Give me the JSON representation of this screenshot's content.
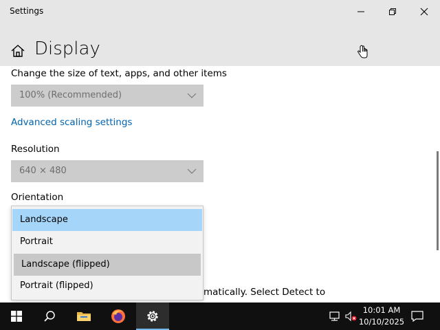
{
  "window": {
    "title": "Settings"
  },
  "header": {
    "title": "Display"
  },
  "scale": {
    "label": "Change the size of text, apps, and other items",
    "value": "100% (Recommended)",
    "advanced_link": "Advanced scaling settings"
  },
  "resolution": {
    "label": "Resolution",
    "value": "640 × 480"
  },
  "orientation": {
    "label": "Orientation",
    "options": [
      "Landscape",
      "Portrait",
      "Landscape (flipped)",
      "Portrait (flipped)"
    ],
    "selected": "Landscape"
  },
  "detect_text": "matically. Select Detect to",
  "taskbar": {
    "time": "10:01 AM",
    "date": "10/10/2025"
  },
  "colors": {
    "accent": "#0063b1",
    "selected_option": "#a6d5fa",
    "taskbar": "#101010"
  }
}
